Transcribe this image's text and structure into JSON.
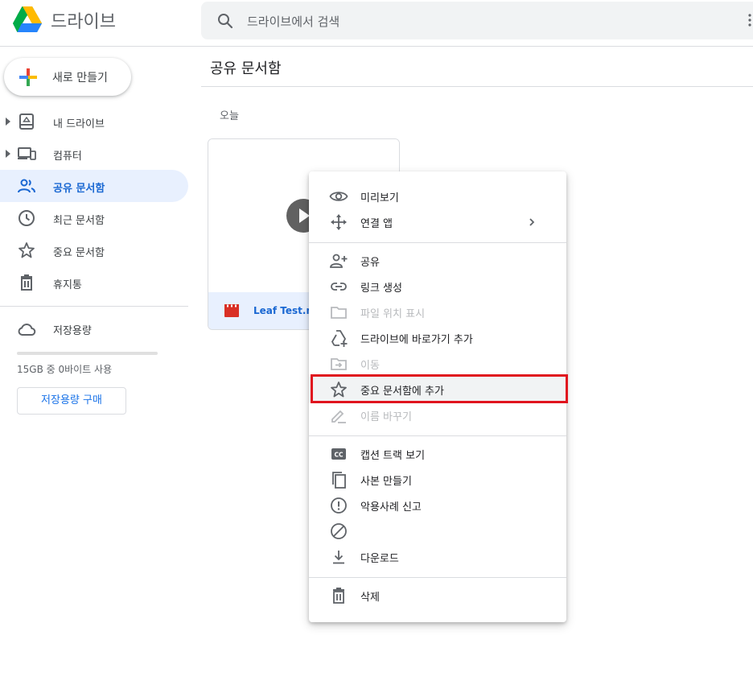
{
  "app": {
    "name": "드라이브"
  },
  "search": {
    "placeholder": "드라이브에서 검색"
  },
  "sidebar": {
    "new_label": "새로 만들기",
    "items": [
      {
        "label": "내 드라이브",
        "icon": "my-drive-icon"
      },
      {
        "label": "컴퓨터",
        "icon": "computer-icon"
      },
      {
        "label": "공유 문서함",
        "icon": "shared-people-icon",
        "active": true
      },
      {
        "label": "최근 문서함",
        "icon": "clock-icon"
      },
      {
        "label": "중요 문서함",
        "icon": "star-icon"
      },
      {
        "label": "휴지통",
        "icon": "trash-icon"
      }
    ],
    "storage": {
      "label": "저장용량",
      "usage_text": "15GB 중 0바이트 사용",
      "used_fraction": 0,
      "buy_label": "저장용량 구매"
    }
  },
  "main": {
    "title": "공유 문서함",
    "section": "오늘",
    "file": {
      "name": "Leaf Test.m",
      "type_icon": "video-file-icon"
    }
  },
  "context_menu": {
    "items": [
      {
        "label": "미리보기",
        "icon": "eye-icon"
      },
      {
        "label": "연결 앱",
        "icon": "move-arrows-icon",
        "submenu": true
      },
      {
        "label": "공유",
        "icon": "person-add-icon"
      },
      {
        "label": "링크 생성",
        "icon": "link-icon"
      },
      {
        "label": "파일 위치 표시",
        "icon": "folder-icon",
        "disabled": true
      },
      {
        "label": "드라이브에 바로가기 추가",
        "icon": "drive-shortcut-icon"
      },
      {
        "label": "이동",
        "icon": "folder-move-icon",
        "disabled": true
      },
      {
        "label": "중요 문서함에 추가",
        "icon": "star-icon",
        "highlighted": true
      },
      {
        "label": "이름 바꾸기",
        "icon": "pencil-icon",
        "disabled": true
      },
      {
        "label": "캡션 트랙 보기",
        "icon": "closed-caption-icon"
      },
      {
        "label": "사본 만들기",
        "icon": "copy-icon"
      },
      {
        "label": "악용사례 신고",
        "icon": "report-icon"
      },
      {
        "label": "",
        "icon": "block-icon"
      },
      {
        "label": "다운로드",
        "icon": "download-icon"
      },
      {
        "label": "삭제",
        "icon": "trash-icon"
      }
    ]
  },
  "colors": {
    "accent": "#1a73e8",
    "active_bg": "#e8f0fe",
    "highlight_border": "#e0141e",
    "icon": "#5f6368",
    "disabled": "#b8babd"
  }
}
